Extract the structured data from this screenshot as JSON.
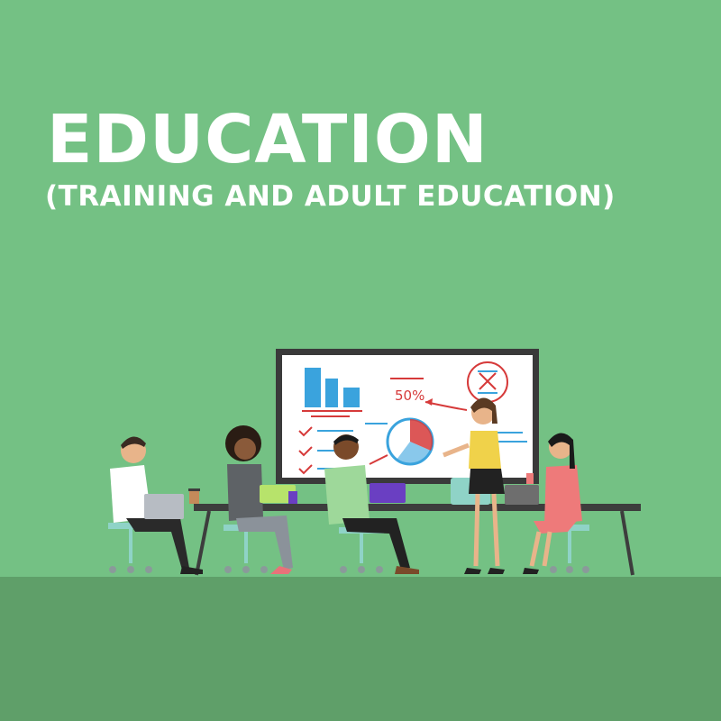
{
  "heading": {
    "title": "EDUCATION",
    "subtitle": "(TRAINING AND ADULT EDUCATION)"
  },
  "whiteboard": {
    "percent_label": "50%"
  },
  "colors": {
    "background": "#74c184",
    "floor": "#5f9f69",
    "text": "#ffffff",
    "board_frame": "#3a3a3a",
    "marker_blue": "#3aa3dd",
    "marker_red": "#d63a3a",
    "chair": "#8fd3c7"
  }
}
